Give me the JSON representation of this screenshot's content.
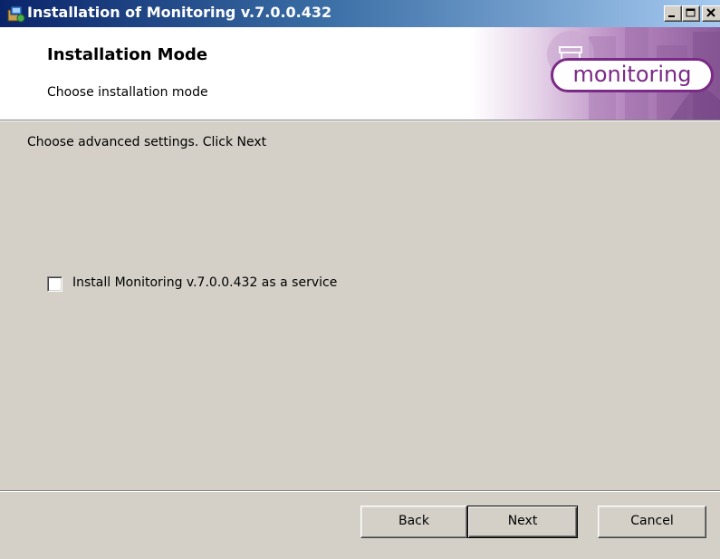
{
  "window": {
    "title": "Installation of Monitoring v.7.0.0.432",
    "icon": "installer-icon",
    "controls": [
      "minimize-icon",
      "maximize-icon",
      "close-icon"
    ]
  },
  "header": {
    "title": "Installation Mode",
    "subtitle": "Choose installation mode",
    "brand": "monitoring"
  },
  "content": {
    "instruction": "Choose advanced settings. Click Next",
    "service_option": {
      "label": "Install Monitoring v.7.0.0.432 as a service",
      "checked": false
    }
  },
  "buttons": {
    "back": "Back",
    "next": "Next",
    "cancel": "Cancel"
  },
  "colors": {
    "titlebar_start": "#0a246a",
    "titlebar_end": "#a6caf0",
    "dialog_bg": "#d4d0c8",
    "brand_purple": "#7a2a86"
  }
}
